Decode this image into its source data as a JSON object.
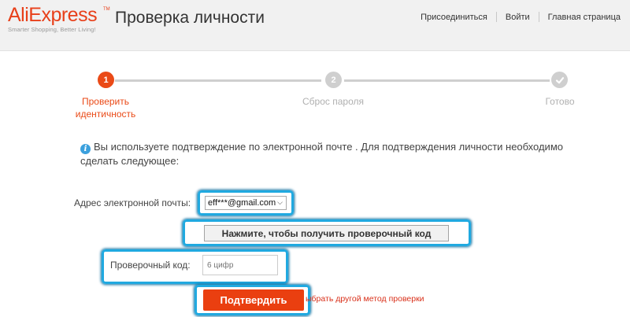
{
  "header": {
    "logo": "AliExpress",
    "logo_tm": "TM",
    "slogan": "Smarter Shopping, Better Living!",
    "title": "Проверка личности",
    "nav": [
      "Присоединиться",
      "Войти",
      "Главная страница"
    ]
  },
  "steps": [
    {
      "number": "1",
      "label_line1": "Проверить",
      "label_line2": "идентичность",
      "status": "active"
    },
    {
      "number": "2",
      "label_line1": "Сброс пароля",
      "label_line2": "",
      "status": "pending"
    },
    {
      "number": "",
      "icon": "check-icon",
      "label_line1": "Готово",
      "label_line2": "",
      "status": "pending"
    }
  ],
  "info": {
    "icon": "info-icon",
    "text": "Вы используете подтверждение по электронной почте . Для подтверждения личности необходимо сделать следующее:"
  },
  "form": {
    "email_label": "Адрес электронной почты:",
    "email_value": "eff***@gmail.com",
    "get_code_button": "Нажмите, чтобы получить проверочный код",
    "code_label": "Проверочный код:",
    "code_placeholder": "6 цифр",
    "confirm_button": "Подтвердить",
    "alt_method_link": "ыбрать другой метод проверки"
  },
  "colors": {
    "brand": "#e8401a",
    "active_step": "#ea4a17",
    "inactive_step": "#cfcfcf",
    "highlight": "#20a9e0",
    "info_icon": "#3ba0dd"
  }
}
